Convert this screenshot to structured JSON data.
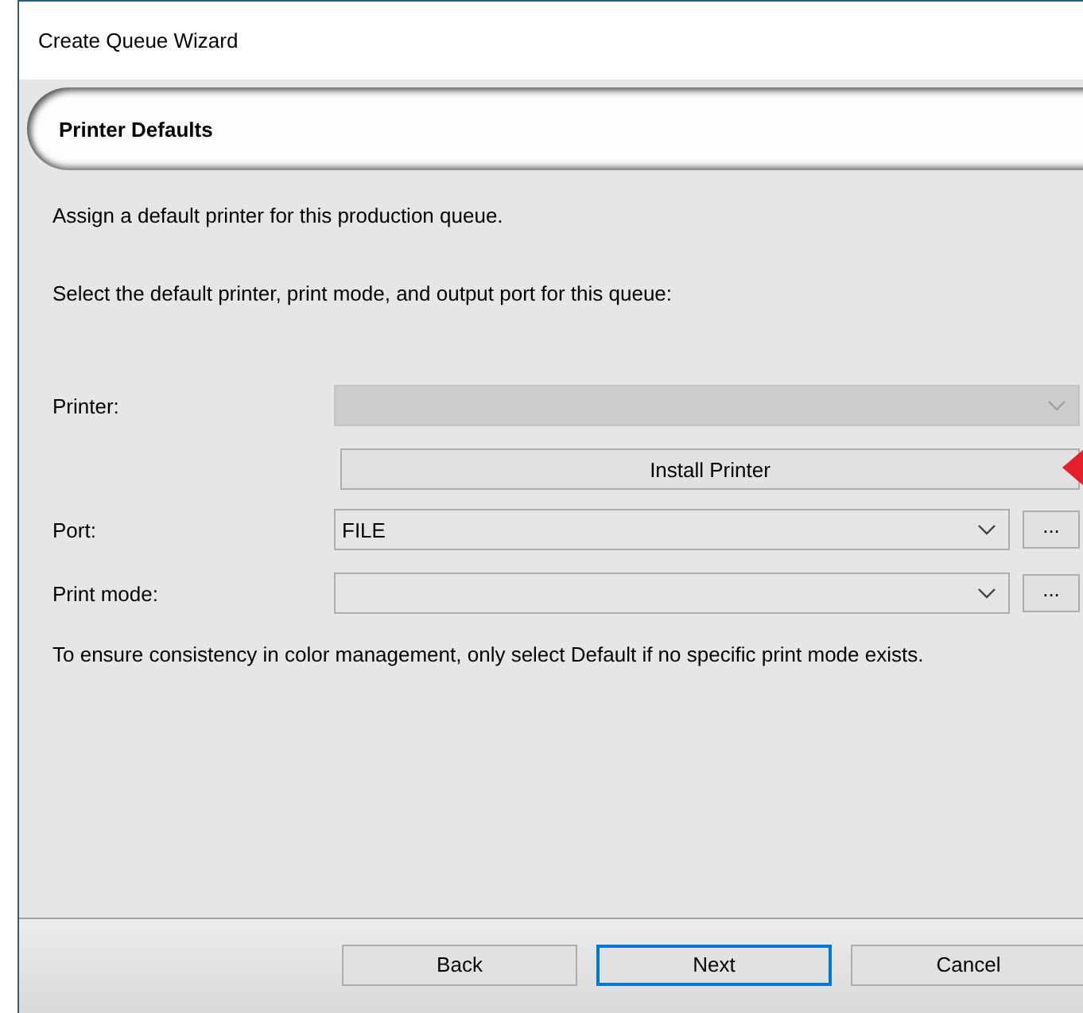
{
  "window": {
    "title": "Create Queue Wizard"
  },
  "header": {
    "title": "Printer Defaults"
  },
  "intro": "Assign a default printer for this production queue.",
  "instruction": "Select the default printer, print mode, and output port for this queue:",
  "fields": [
    {
      "kind": "combo",
      "label": "Printer:",
      "disabled": true
    },
    {
      "kind": "button",
      "label": "Install Printer"
    },
    {
      "kind": "combo",
      "label": "Port:",
      "value": "FILE",
      "disabled": false,
      "browse_label": "..."
    },
    {
      "kind": "combo",
      "label": "Print mode:",
      "disabled": false,
      "browse_label": "..."
    }
  ],
  "note": "To ensure consistency in color management, only select Default if no specific print mode exists.",
  "buttons": [
    {
      "label": "Back",
      "default": false
    },
    {
      "label": "Next",
      "default": true
    },
    {
      "label": "Cancel",
      "default": false
    }
  ]
}
